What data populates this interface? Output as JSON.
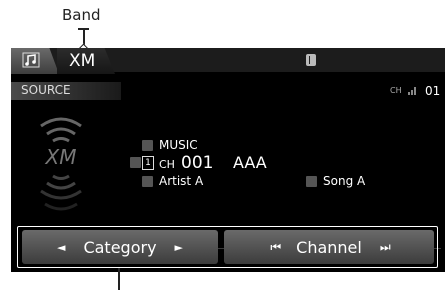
{
  "callout": {
    "band_label": "Band"
  },
  "tabs": {
    "music_icon": "music-note-icon",
    "xm_label": "XM"
  },
  "header": {
    "bluetooth_icon": "bluetooth-icon",
    "source_label": "SOURCE",
    "ch_label": "CH",
    "ch_number": "01"
  },
  "info": {
    "category_name": "MUSIC",
    "preset_number": "1",
    "ch_prefix": "CH",
    "channel_number": "001",
    "station_name": "AAA",
    "artist": "Artist A",
    "song": "Song A"
  },
  "controls": {
    "category_label": "Category",
    "channel_label": "Channel",
    "left_arrow": "◄",
    "right_arrow": "►",
    "skip_back": "⏮",
    "skip_forward": "⏭"
  },
  "colors": {
    "screen_bg": "#000000",
    "button_top": "#6a6a6a",
    "button_bottom": "#3c3c3c"
  }
}
